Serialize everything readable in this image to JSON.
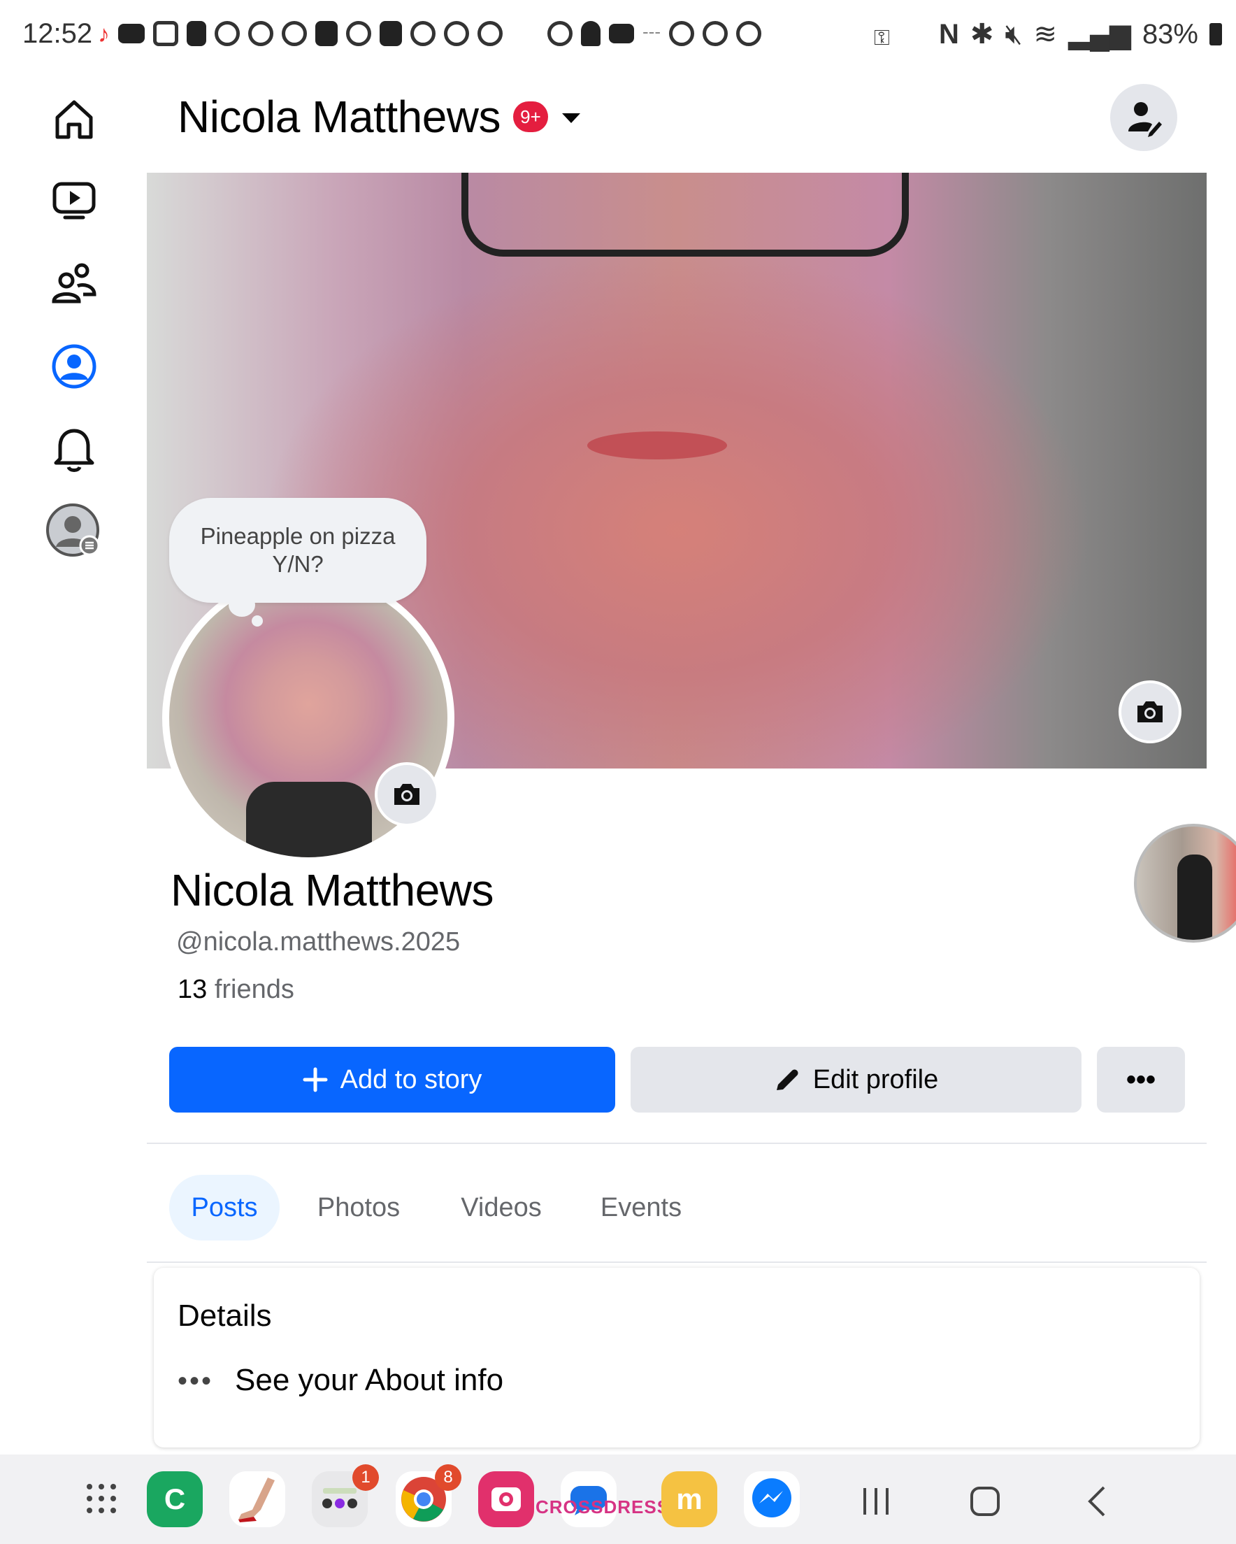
{
  "status_bar": {
    "time": "12:52",
    "battery": "83%"
  },
  "nav_rail": {
    "items": [
      "home-icon",
      "video-icon",
      "friends-icon",
      "profile-icon",
      "bell-icon",
      "account-icon"
    ]
  },
  "header": {
    "name": "Nicola Matthews",
    "badge": "9+"
  },
  "thought_bubble": {
    "line1": "Pineapple on pizza",
    "line2": "Y/N?"
  },
  "profile": {
    "name": "Nicola Matthews",
    "handle": "@nicola.matthews.2025",
    "friends_count": "13",
    "friends_label": " friends"
  },
  "actions": {
    "add_story": "Add to story",
    "edit_profile": "Edit profile",
    "more": "•••"
  },
  "tabs": [
    {
      "label": "Posts",
      "active": true
    },
    {
      "label": "Photos",
      "active": false
    },
    {
      "label": "Videos",
      "active": false
    },
    {
      "label": "Events",
      "active": false
    }
  ],
  "details": {
    "title": "Details",
    "about_link": "See your About info"
  },
  "dock": {
    "app_badge_1": "1",
    "app_badge_2": "8",
    "watermark": "CROSSDRESSING"
  },
  "colors": {
    "accent": "#0866ff",
    "badge": "#e41e3f",
    "button_grey": "#e4e6eb"
  }
}
